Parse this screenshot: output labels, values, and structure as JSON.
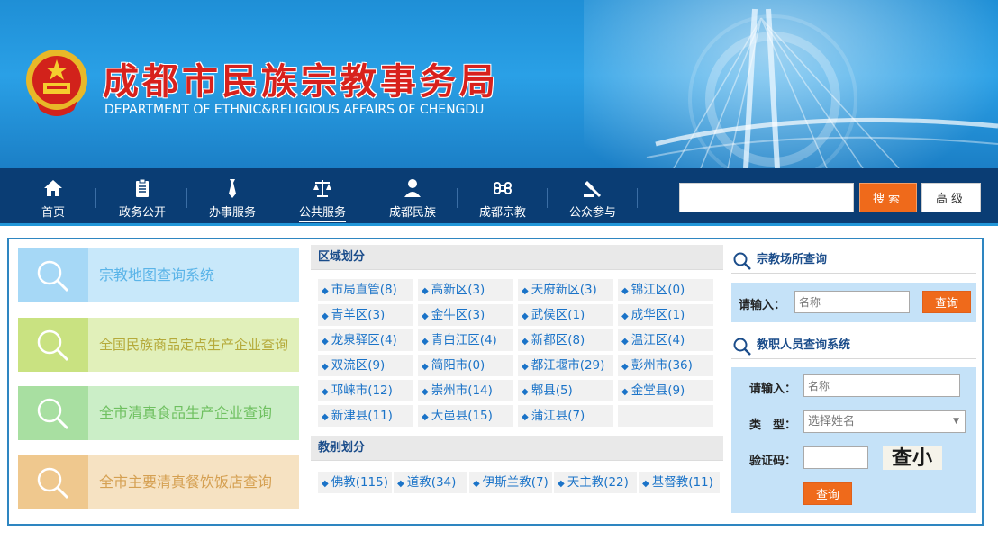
{
  "header": {
    "title_cn": "成都市民族宗教事务局",
    "title_en": "DEPARTMENT OF ETHNIC&RELIGIOUS AFFAIRS OF CHENGDU"
  },
  "nav": {
    "items": [
      {
        "label": "首页",
        "icon": "home-icon"
      },
      {
        "label": "政务公开",
        "icon": "clipboard-icon"
      },
      {
        "label": "办事服务",
        "icon": "tie-icon"
      },
      {
        "label": "公共服务",
        "icon": "scales-icon",
        "active": true
      },
      {
        "label": "成都民族",
        "icon": "person-icon"
      },
      {
        "label": "成都宗教",
        "icon": "command-icon"
      },
      {
        "label": "公众参与",
        "icon": "gavel-icon"
      }
    ],
    "search_value": "",
    "search_button": "搜索",
    "advanced_button": "高级"
  },
  "tiles": [
    {
      "label": "宗教地图查询系统"
    },
    {
      "label": "全国民族商品定点生产企业查询"
    },
    {
      "label": "全市清真食品生产企业查询"
    },
    {
      "label": "全市主要清真餐饮饭店查询"
    }
  ],
  "regions": {
    "heading": "区域划分",
    "items": [
      "市局直管(8)",
      "高新区(3)",
      "天府新区(3)",
      "锦江区(0)",
      "青羊区(3)",
      "金牛区(3)",
      "武侯区(1)",
      "成华区(1)",
      "龙泉驿区(4)",
      "青白江区(4)",
      "新都区(8)",
      "温江区(4)",
      "双流区(9)",
      "简阳市(0)",
      "都江堰市(29)",
      "彭州市(36)",
      "邛崃市(12)",
      "崇州市(14)",
      "郫县(5)",
      "金堂县(9)",
      "新津县(11)",
      "大邑县(15)",
      "蒲江县(7)",
      ""
    ]
  },
  "religions": {
    "heading": "教别划分",
    "items": [
      "佛教(115)",
      "道教(34)",
      "伊斯兰教(7)",
      "天主教(22)",
      "基督教(11)"
    ]
  },
  "venue_query": {
    "heading": "宗教场所查询",
    "input_label": "请输入：",
    "placeholder": "名称",
    "button": "查询"
  },
  "staff_query": {
    "heading": "教职人员查询系统",
    "input_label": "请输入：",
    "placeholder": "名称",
    "type_label": "类　型：",
    "type_value": "选择姓名",
    "captcha_label": "验证码：",
    "captcha_value": "",
    "captcha_text": "查小",
    "button": "查询"
  },
  "colors": {
    "nav_bg": "#0a3d74",
    "accent_orange": "#ef6a1b",
    "title_red": "#d8211c",
    "link_blue": "#1a73c8"
  }
}
